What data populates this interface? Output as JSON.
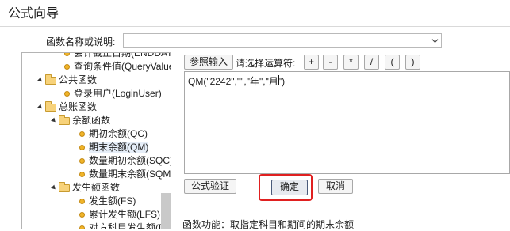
{
  "window": {
    "title": "公式向导"
  },
  "function_select": {
    "label": "函数名称或说明:",
    "value": ""
  },
  "tree": {
    "items": [
      {
        "label": "会计截止日期(ENDDATE)",
        "kind": "leaf"
      },
      {
        "label": "查询条件值(QueryValue)",
        "kind": "leaf"
      },
      {
        "label": "公共函数",
        "kind": "folder"
      },
      {
        "label": "登录用户(LoginUser)",
        "kind": "leaf"
      },
      {
        "label": "总账函数",
        "kind": "folder"
      },
      {
        "label": "余额函数",
        "kind": "folder"
      },
      {
        "label": "期初余额(QC)",
        "kind": "leaf"
      },
      {
        "label": "期末余额(QM)",
        "kind": "leaf",
        "selected": true
      },
      {
        "label": "数量期初余额(SQC)",
        "kind": "leaf"
      },
      {
        "label": "数量期末余额(SQM)",
        "kind": "leaf"
      },
      {
        "label": "发生额函数",
        "kind": "folder"
      },
      {
        "label": "发生额(FS)",
        "kind": "leaf"
      },
      {
        "label": "累计发生额(LFS)",
        "kind": "leaf"
      },
      {
        "label": "对方科目发生额(DFS)",
        "kind": "leaf"
      }
    ]
  },
  "toolbar": {
    "ref_input_label": "参照输入",
    "operator_label": "请选择运算符:",
    "operators": [
      "+",
      "-",
      "*",
      "/",
      "(",
      ")"
    ]
  },
  "formula": {
    "text": "QM(\"2242\",\"\",\"年\",\"月\")"
  },
  "buttons": {
    "validate": "公式验证",
    "ok": "确定",
    "cancel": "取消"
  },
  "description": {
    "text": "函数功能：取指定科目和期间的期末余额"
  },
  "colors": {
    "highlight": "#e02020",
    "folder": "#f7d27a",
    "leaf_dot": "#f0b429"
  }
}
